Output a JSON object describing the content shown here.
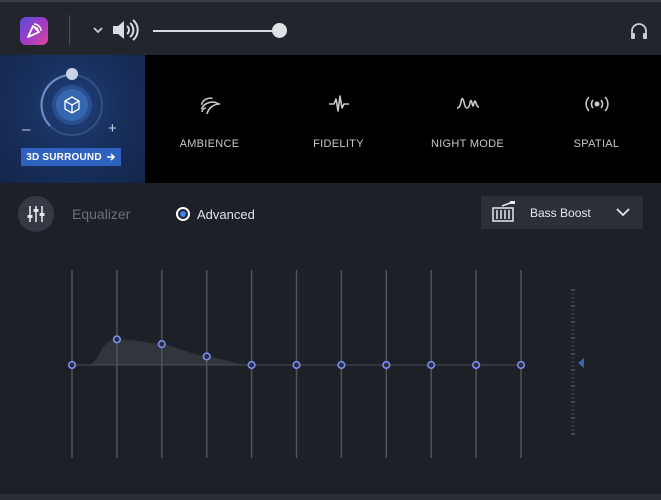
{
  "topbar": {
    "logo_icon": "app-logo-icon",
    "volume_icon": "speaker-icon",
    "volume_level": 1.0,
    "device_icon": "headphone-icon"
  },
  "surround": {
    "button_label": "3D SURROUND",
    "minus": "–",
    "plus": "+",
    "level": 0.5,
    "accent": "#2f62c0"
  },
  "effects": [
    {
      "id": "ambience",
      "label": "AMBIENCE",
      "icon": "ambience-icon"
    },
    {
      "id": "fidelity",
      "label": "FIDELITY",
      "icon": "fidelity-icon"
    },
    {
      "id": "night-mode",
      "label": "NIGHT MODE",
      "icon": "night-mode-icon"
    },
    {
      "id": "spatial",
      "label": "SPATIAL",
      "icon": "spatial-icon"
    }
  ],
  "equalizer": {
    "label": "Equalizer",
    "mode_label": "Advanced",
    "mode_selected": true,
    "preset": {
      "label": "Bass Boost",
      "icon": "bass-boost-icon"
    },
    "band_gains": [
      0,
      0.27,
      0.22,
      0.09,
      0,
      0,
      0,
      0,
      0,
      0,
      0
    ],
    "band_count": 11,
    "accent": "#7c8ff0"
  }
}
